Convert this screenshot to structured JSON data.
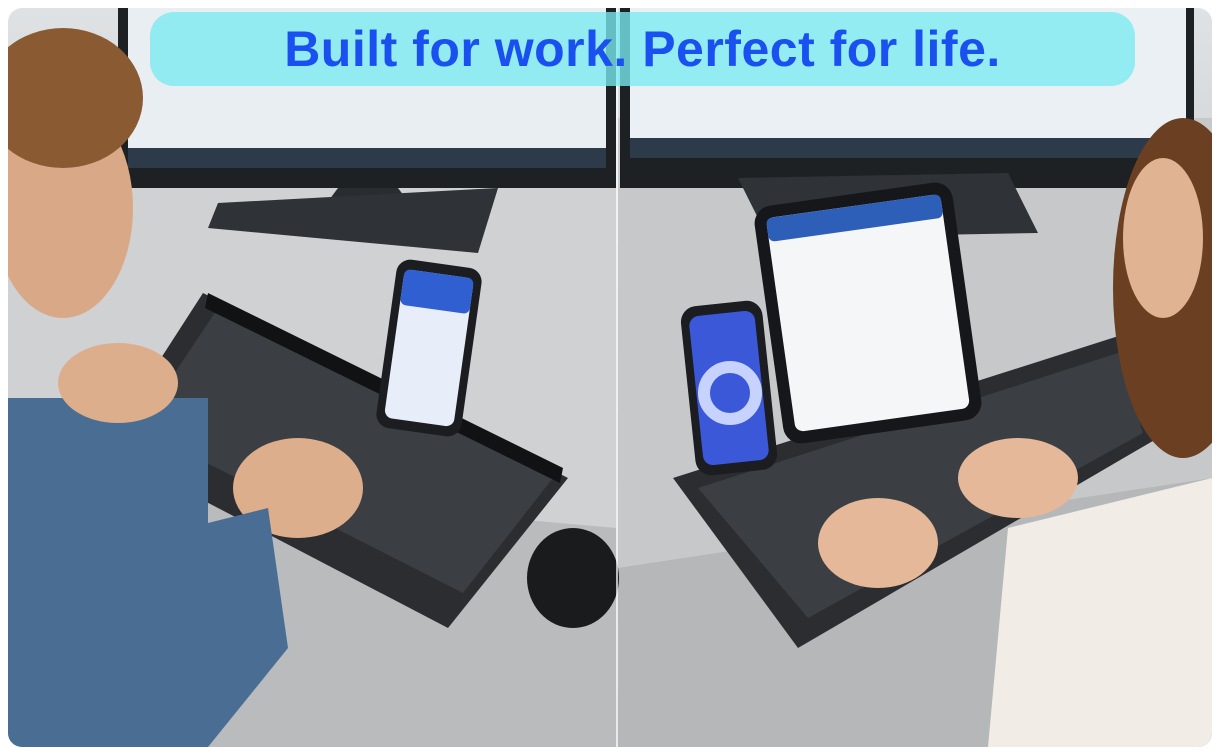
{
  "banner": {
    "headline": "Built for work. Perfect for life."
  },
  "colors": {
    "banner_bg": "#78ebf0",
    "headline_text": "#1a4ff0",
    "desk": "#c9cbcd",
    "keyboard": "#2b2d30",
    "monitor": "#1e2124"
  },
  "scene": {
    "left_person": "man typing on wireless keyboard with phone docked",
    "right_person": "woman typing on wireless keyboard with phone and tablet docked"
  }
}
